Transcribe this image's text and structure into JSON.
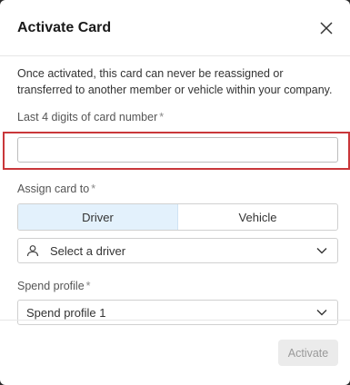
{
  "dialog": {
    "title": "Activate Card",
    "description": "Once activated, this card can never be reassigned or transferred to another member or vehicle within your company."
  },
  "card_number": {
    "label": "Last 4 digits of card number",
    "required_marker": "*",
    "value": "",
    "placeholder": ""
  },
  "assign": {
    "label": "Assign card to",
    "required_marker": "*",
    "options": [
      "Driver",
      "Vehicle"
    ],
    "selected": "Driver"
  },
  "driver_select": {
    "placeholder": "Select a driver",
    "icon": "person-icon"
  },
  "spend_profile": {
    "label": "Spend profile",
    "required_marker": "*",
    "value": "Spend profile 1"
  },
  "footer": {
    "activate_label": "Activate"
  },
  "colors": {
    "highlight_border": "#c9373a",
    "segment_active_bg": "#e3f1fc",
    "disabled_button_bg": "#ebebeb"
  }
}
